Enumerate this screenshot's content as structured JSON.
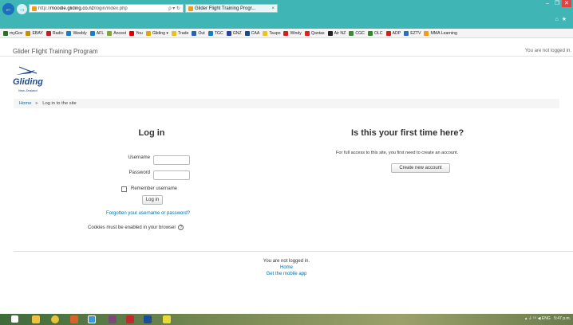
{
  "browser": {
    "url_prefix": "http://",
    "url_domain": "moodle.gliding.co.nz",
    "url_path": "/login/index.php",
    "address_icons": "ρ ▾ ↻",
    "tab_title": "Glider Flight Training Progr...",
    "tab_close": "×",
    "back_icon": "arrow-left-icon",
    "forward_icon": "arrow-right-icon"
  },
  "favorites": [
    {
      "label": "myGov",
      "color": "#2a6e2a"
    },
    {
      "label": "EBAY",
      "color": "#c49000"
    },
    {
      "label": "Radio",
      "color": "#b22"
    },
    {
      "label": "Weebly",
      "color": "#1a7cc4"
    },
    {
      "label": "AFL",
      "color": "#1a7cc4"
    },
    {
      "label": "Ancest",
      "color": "#7aa83a"
    },
    {
      "label": "You",
      "color": "#d00"
    },
    {
      "label": "Gliding ▾",
      "color": "#e2a800"
    },
    {
      "label": "Trade",
      "color": "#e8c020"
    },
    {
      "label": "Out",
      "color": "#2266bb"
    },
    {
      "label": "TGC",
      "color": "#1a7cc4"
    },
    {
      "label": "GNZ",
      "color": "#2244aa"
    },
    {
      "label": "CAA",
      "color": "#1a4a8a"
    },
    {
      "label": "Taupo",
      "color": "#f0c020"
    },
    {
      "label": "Windy",
      "color": "#c22"
    },
    {
      "label": "Qantas",
      "color": "#d22"
    },
    {
      "label": "Air NZ",
      "color": "#222"
    },
    {
      "label": "CGC",
      "color": "#3a8a3a"
    },
    {
      "label": "OLC",
      "color": "#2c8a2c"
    },
    {
      "label": "ADP",
      "color": "#c22"
    },
    {
      "label": "EZTV",
      "color": "#2a6fc0"
    },
    {
      "label": "MMA Learning",
      "color": "#f29b1d"
    }
  ],
  "header": {
    "site_title": "Glider Flight Training Program",
    "login_status": "You are not logged in."
  },
  "logo": {
    "word": "Gliding",
    "sub": "New Zealand"
  },
  "breadcrumb": {
    "home": "Home",
    "separator": "►",
    "current": "Log in to the site"
  },
  "login": {
    "title": "Log in",
    "username_label": "Username",
    "password_label": "Password",
    "remember_label": "Remember username",
    "button": "Log in",
    "forgot_link": "Forgotten your username or password?",
    "cookies_note": "Cookies must be enabled in your browser",
    "help_icon": "?"
  },
  "signup": {
    "title": "Is this your first time here?",
    "text": "For full access to this site, you first need to create an account.",
    "button": "Create new account"
  },
  "footer": {
    "status": "You are not logged in.",
    "home": "Home",
    "mobile_app": "Get the mobile app"
  },
  "taskbar": {
    "tray": "▴ ⏚ ⁽¹⁾ ◀ ENG",
    "time": "5:47 p.m."
  }
}
